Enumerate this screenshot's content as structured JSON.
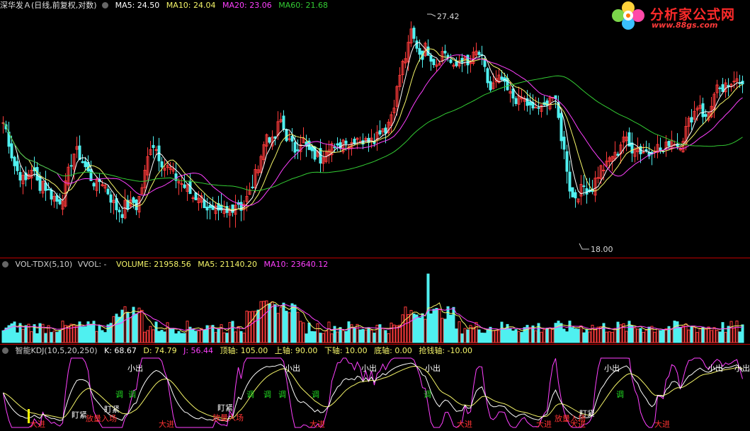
{
  "main_header": {
    "title": "深华发Ａ(日线,前复权,对数)",
    "ma5": "MA5: 24.50",
    "ma10": "MA10: 24.04",
    "ma20": "MA20: 23.06",
    "ma60": "MA60: 21.68"
  },
  "price_labels": {
    "high": "27.42",
    "low": "18.00"
  },
  "vol_header": {
    "title": "VOL-TDX(5,10)",
    "vvol": "VVOL: -",
    "volume": "VOLUME: 21958.56",
    "ma5": "MA5: 21140.20",
    "ma10": "MA10: 23640.12"
  },
  "kdj_header": {
    "title": "智能KDJ(10,5,20,250)",
    "k": "K: 68.67",
    "d": "D: 74.79",
    "j": "J: 56.44",
    "top": "顶轴: 105.00",
    "upper": "上轴: 90.00",
    "lower": "下轴: 10.00",
    "bottom": "底轴: 0.00",
    "grab": "抢钱轴: -10.00"
  },
  "logo": {
    "text": "分析家公式网",
    "url": "www.88gs.com"
  },
  "signals": [
    {
      "text": "小出",
      "color": "#ffffff"
    },
    {
      "text": "小出",
      "color": "#ffffff"
    },
    {
      "text": "小出",
      "color": "#ffffff"
    },
    {
      "text": "小出",
      "color": "#ffffff"
    },
    {
      "text": "小出",
      "color": "#ffffff"
    },
    {
      "text": "小出",
      "color": "#ffffff"
    },
    {
      "text": "小出",
      "color": "#ffffff"
    },
    {
      "text": "调",
      "color": "#22dd22"
    },
    {
      "text": "调",
      "color": "#22dd22"
    },
    {
      "text": "调",
      "color": "#22dd22"
    },
    {
      "text": "调",
      "color": "#22dd22"
    },
    {
      "text": "调",
      "color": "#22dd22"
    },
    {
      "text": "调",
      "color": "#22dd22"
    },
    {
      "text": "调",
      "color": "#22dd22"
    },
    {
      "text": "调",
      "color": "#22dd22"
    },
    {
      "text": "盯紧",
      "color": "#ffffff"
    },
    {
      "text": "盯紧",
      "color": "#ffffff"
    },
    {
      "text": "盯紧",
      "color": "#ffffff"
    },
    {
      "text": "盯紧",
      "color": "#ffffff"
    },
    {
      "text": "放量入场",
      "color": "#ff3333"
    },
    {
      "text": "放量入场",
      "color": "#ff3333"
    },
    {
      "text": "放量入场",
      "color": "#ff3333"
    },
    {
      "text": "大进",
      "color": "#ff3333"
    },
    {
      "text": "大进",
      "color": "#ff3333"
    },
    {
      "text": "大进",
      "color": "#ff3333"
    },
    {
      "text": "大进",
      "color": "#ff3333"
    },
    {
      "text": "大进",
      "color": "#ff3333"
    },
    {
      "text": "大进",
      "color": "#ff3333"
    },
    {
      "text": "大进",
      "color": "#ff3333"
    }
  ],
  "colors": {
    "up": "#ff3b3b",
    "down": "#4ff0f0",
    "ma5": "#ffffff",
    "ma10": "#f5f569",
    "ma20": "#ff40ff",
    "ma60": "#33cc33",
    "k": "#ffffff",
    "d": "#f5f569",
    "j": "#ff40ff",
    "separator": "#c00000"
  },
  "chart_data": {
    "type": "candlestick",
    "bars": 300,
    "price_close": [
      22.8,
      22.4,
      21.6,
      21.0,
      20.7,
      20.5,
      20.2,
      20.6,
      20.9,
      20.4,
      20.1,
      20.3,
      20.0,
      19.8,
      19.7,
      19.5,
      19.6,
      19.9,
      20.6,
      21.2,
      21.6,
      21.4,
      21.1,
      20.8,
      20.5,
      20.3,
      20.1,
      20.4,
      20.2,
      19.9,
      19.6,
      19.3,
      19.2,
      19.1,
      19.4,
      19.3,
      19.5,
      19.3,
      19.8,
      20.4,
      21.2,
      21.9,
      21.8,
      21.4,
      21.1,
      20.8,
      20.9,
      20.6,
      20.4,
      20.3,
      20.1,
      20.0,
      19.8,
      19.6,
      19.8,
      19.6,
      19.4,
      19.2,
      19.0,
      19.1,
      18.9,
      19.1,
      19.0,
      19.2,
      19.4,
      19.5,
      19.3,
      19.5,
      19.7,
      20.1,
      20.6,
      21.2,
      21.6,
      22.3,
      22.1,
      21.8,
      22.6,
      22.9,
      22.4,
      22.0,
      21.8,
      21.6,
      21.9,
      22.1,
      21.7,
      21.5,
      21.3,
      21.4,
      21.2,
      21.6,
      21.8,
      21.9,
      21.5,
      21.7,
      22.0,
      22.1,
      21.8,
      22.0,
      22.2,
      22.1,
      21.9,
      22.0,
      22.3,
      22.1,
      22.4,
      22.6,
      22.5,
      22.9,
      23.4,
      24.2,
      25.1,
      25.8,
      26.1,
      27.4,
      26.8,
      26.4,
      25.9,
      26.5,
      26.2,
      25.8,
      25.6,
      25.9,
      26.3,
      26.1,
      25.7,
      25.3,
      25.6,
      25.9,
      25.8,
      25.4,
      25.9,
      26.2,
      26.1,
      25.7,
      24.9,
      24.3,
      24.6,
      24.8,
      24.9,
      24.5,
      24.2,
      24.0,
      23.9,
      23.8,
      24.0,
      23.7,
      23.5,
      23.3,
      23.6,
      23.4,
      23.5,
      23.9,
      24.1,
      23.8,
      22.9,
      21.9,
      21.2,
      20.1,
      19.6,
      19.8,
      19.9,
      20.1,
      20.0,
      19.9,
      20.3,
      20.6,
      20.9,
      20.8,
      21.2,
      21.4,
      21.3,
      21.8,
      22.2,
      21.9,
      21.6,
      21.8,
      21.7,
      21.5,
      21.6,
      21.4,
      21.7,
      21.8,
      21.6,
      21.5,
      21.8,
      22.1,
      22.0,
      21.8,
      21.9,
      22.4,
      22.8,
      23.1,
      23.4,
      23.8,
      23.2,
      22.9,
      23.5,
      24.0,
      24.4,
      24.1,
      24.5,
      24.3,
      24.7,
      25.1,
      24.9,
      24.5
    ],
    "yrange": [
      17.5,
      28.5
    ]
  }
}
